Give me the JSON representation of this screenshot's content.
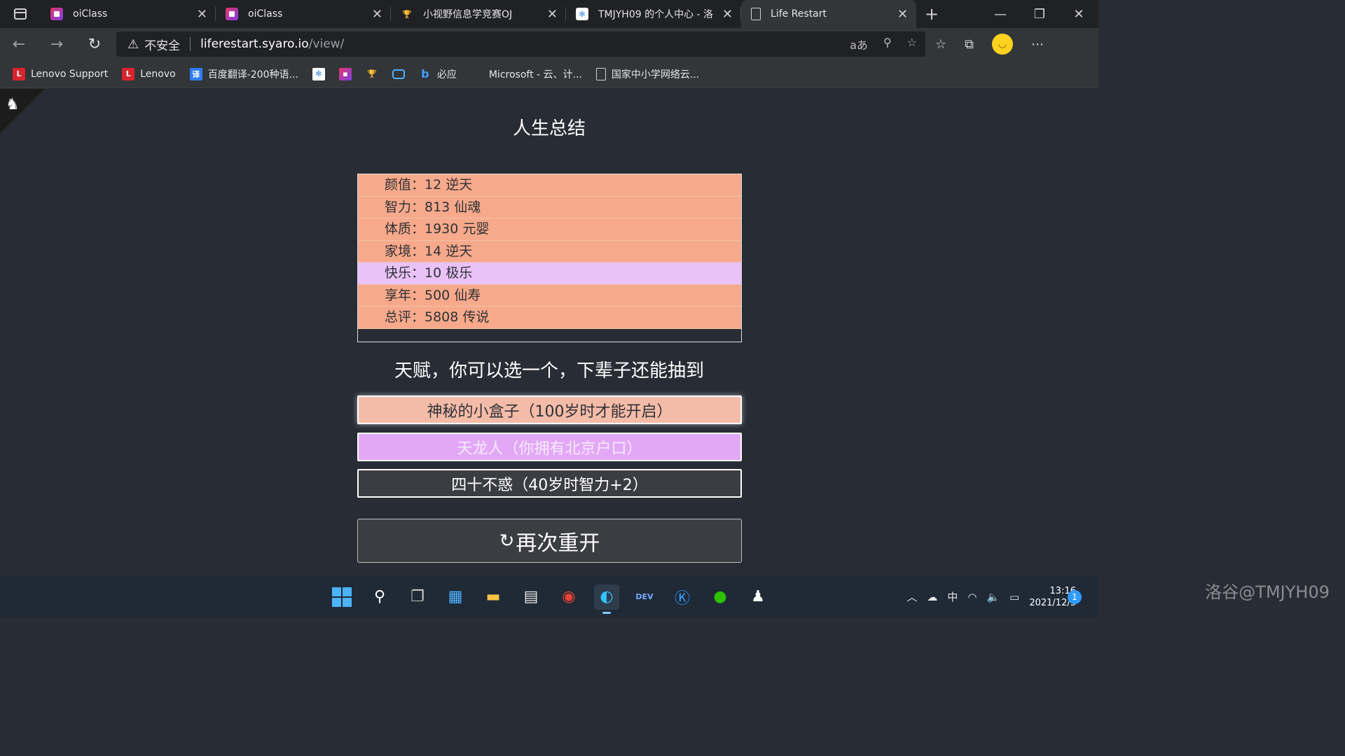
{
  "tabs": [
    {
      "title": "oiClass",
      "icon": "oiclass-icon",
      "active": false
    },
    {
      "title": "oiClass",
      "icon": "oiclass-icon",
      "active": false
    },
    {
      "title": "小视野信息学竞赛OJ",
      "icon": "cup-icon",
      "active": false
    },
    {
      "title": "TMJYH09 的个人中心 - 洛",
      "icon": "luogu-icon",
      "active": false
    },
    {
      "title": "Life Restart",
      "icon": "document-icon",
      "active": true
    }
  ],
  "address": {
    "security": "不安全",
    "host": "liferestart.syaro.io",
    "path": "/view/"
  },
  "bookmarks": [
    {
      "label": "Lenovo Support",
      "icon": "lenovo-support-icon"
    },
    {
      "label": "Lenovo",
      "icon": "lenovo-icon"
    },
    {
      "label": "百度翻译-200种语...",
      "icon": "translate-icon"
    },
    {
      "label": "",
      "icon": "luogu-icon"
    },
    {
      "label": "",
      "icon": "oiclass-icon"
    },
    {
      "label": "",
      "icon": "cup-icon"
    },
    {
      "label": "",
      "icon": "bilibili-icon"
    },
    {
      "label": "必应",
      "icon": "bing-icon"
    },
    {
      "label": "Microsoft - 云、计...",
      "icon": "microsoft-icon"
    },
    {
      "label": "国家中小学网络云...",
      "icon": "document-icon"
    }
  ],
  "page": {
    "summary_title": "人生总结",
    "stats": [
      {
        "label": "颜值：12 逆天",
        "color": "#f7a98b"
      },
      {
        "label": "智力：813 仙魂",
        "color": "#f7a98b"
      },
      {
        "label": "体质：1930 元婴",
        "color": "#f7a98b"
      },
      {
        "label": "家境：14 逆天",
        "color": "#f7a98b"
      },
      {
        "label": "快乐：10 极乐",
        "color": "#e9c2f7"
      },
      {
        "label": "享年：500 仙寿",
        "color": "#f7a98b"
      },
      {
        "label": "总评：5808 传说",
        "color": "#f7a98b"
      }
    ],
    "talent_prompt": "天赋，你可以选一个，下辈子还能抽到",
    "talents": [
      {
        "label": "神秘的小盒子（100岁时才能开启）"
      },
      {
        "label": "天龙人（你拥有北京户口）"
      },
      {
        "label": "四十不惑（40岁时智力+2）"
      }
    ],
    "restart_label": "再次重开"
  },
  "taskbar": {
    "apps": [
      "windows-start-icon",
      "search-icon",
      "task-view-icon",
      "widgets-icon",
      "file-explorer-icon",
      "microsoft-store-icon",
      "chrome-icon",
      "edge-icon",
      "dev-cpp-icon",
      "kugou-icon",
      "wechat-icon",
      "qq-icon"
    ],
    "ime": "中",
    "time": "13:16",
    "date": "2021/12/5",
    "notifications": "1"
  },
  "watermark": "洛谷@TMJYH09"
}
